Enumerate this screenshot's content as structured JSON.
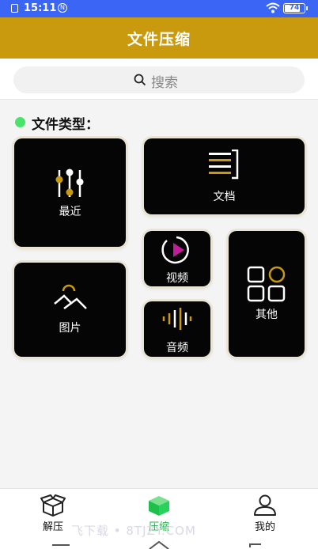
{
  "status_bar": {
    "time": "15:11",
    "battery": "74"
  },
  "header": {
    "title": "文件压缩"
  },
  "search": {
    "placeholder": "搜索"
  },
  "section": {
    "title": "文件类型："
  },
  "tiles": {
    "recent": "最近",
    "docs": "文档",
    "video": "视频",
    "other": "其他",
    "images": "图片",
    "audio": "音频"
  },
  "nav": {
    "decompress": "解压",
    "compress": "压缩",
    "mine": "我的"
  },
  "watermark": "飞下载 • 8TJZY.COM",
  "colors": {
    "header": "#c99a0e",
    "accent": "#c99a0e",
    "active_nav": "#21b24b",
    "status_bar": "#3b66f5",
    "video_icon": "#c21b9c"
  }
}
